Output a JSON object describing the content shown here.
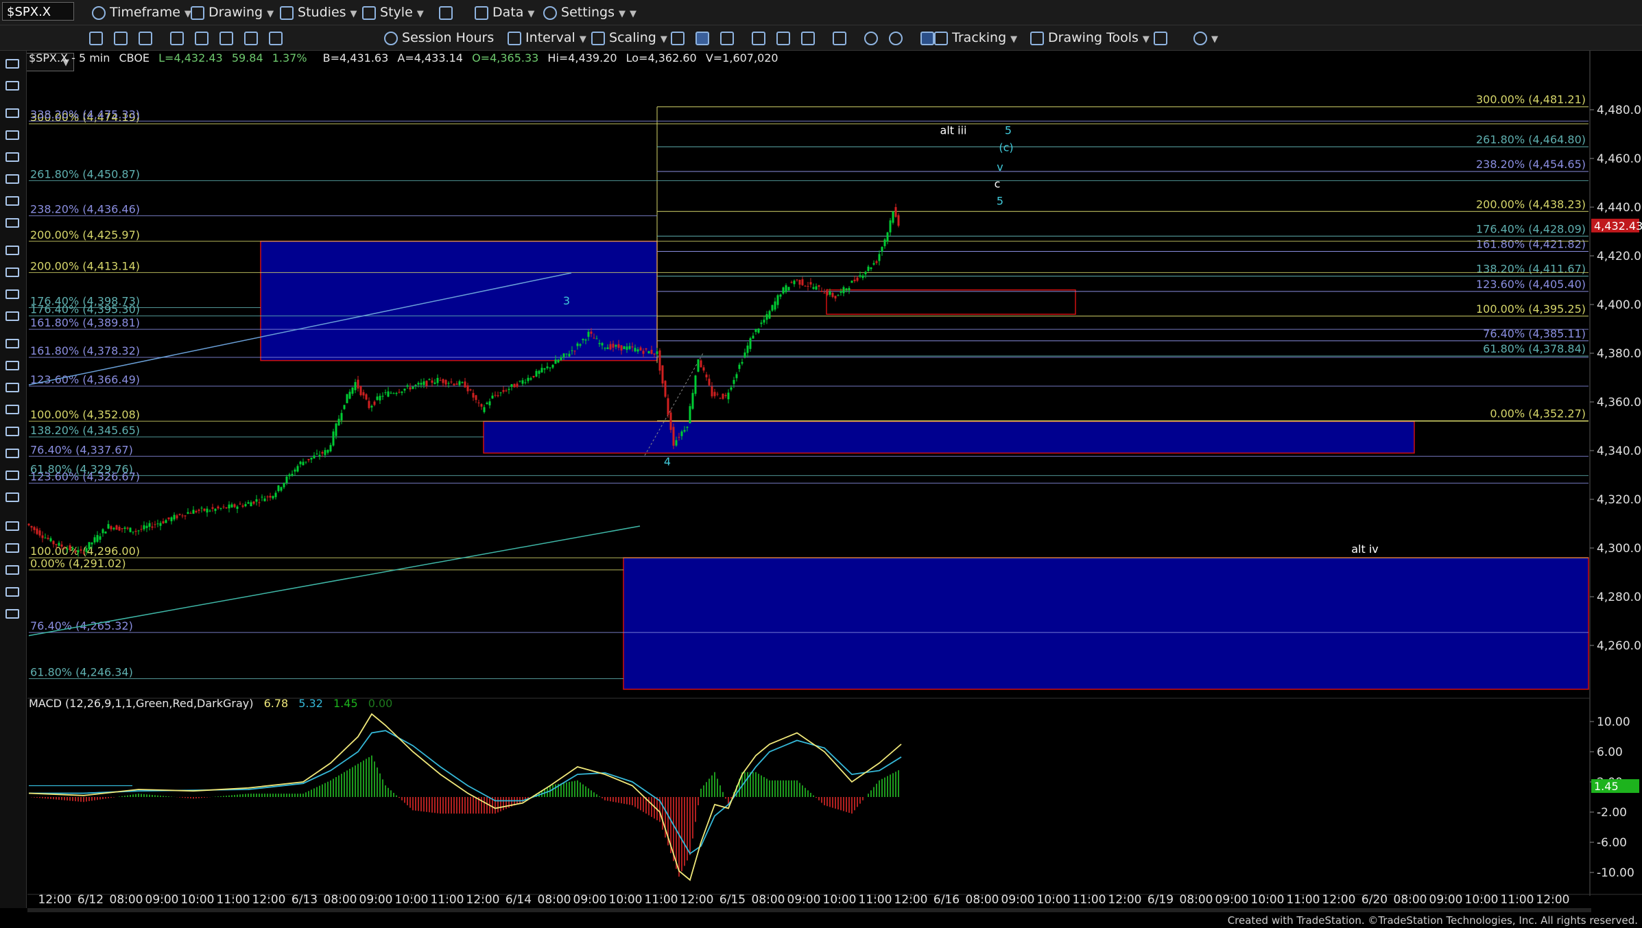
{
  "toolbar": {
    "symbol": "$SPX.X",
    "timeframe": "Timeframe",
    "drawing": "Drawing",
    "studies": "Studies",
    "style": "Style",
    "data": "Data",
    "settings": "Settings",
    "session_hours": "Session Hours",
    "interval": "Interval",
    "scaling": "Scaling",
    "tracking": "Tracking",
    "drawing_tools": "Drawing Tools"
  },
  "header": {
    "symbol": "$SPX.X - 5 min",
    "exchange": "CBOE",
    "last": "L=4,432.43",
    "net_change": "59.84",
    "pct_change": "1.37%",
    "bid": "B=4,431.63",
    "ask": "A=4,433.14",
    "open": "O=4,365.33",
    "high": "Hi=4,439.20",
    "low": "Lo=4,362.60",
    "volume": "V=1,607,020"
  },
  "macd_label": {
    "name": "MACD (12,26,9,1,1,Green,Red,DarkGray)",
    "v1": "6.78",
    "v2": "5.32",
    "v3": "1.45",
    "v4": "0.00"
  },
  "credit": "Created with TradeStation. ©TradeStation Technologies, Inc. All rights reserved.",
  "colors": {
    "background": "#000000",
    "toolbar": "#1b1b1b",
    "zone_fill": "#00008f",
    "zone_border": "#d01010",
    "price_line": "#00cc33",
    "fib_yellow": "#d6d66a",
    "fib_blue": "#8a8ee0",
    "fib_teal": "#5fb0b0",
    "macd_line": "#f0e87a",
    "signal_line": "#35b8d8",
    "hist_pos": "#1d9a1d",
    "hist_neg": "#b02020",
    "last_price_tag": "#c0181c",
    "macd_tag": "#1db31d"
  },
  "chart_data": [
    {
      "type": "candlestick",
      "title": "$SPX.X - 5 min",
      "ylim": [
        4240,
        4490
      ],
      "y_ticks": [
        4260,
        4280,
        4300,
        4320,
        4340,
        4360,
        4380,
        4400,
        4420,
        4440,
        4460,
        4480
      ],
      "y_tick_labels": [
        "4,260.00",
        "4,280.00",
        "4,300.00",
        "4,320.00",
        "4,340.00",
        "4,360.00",
        "4,380.00",
        "4,400.00",
        "4,420.00",
        "4,440.00",
        "4,460.00",
        "4,480.00"
      ],
      "last_price": 4432.43,
      "last_price_label": "4,432.43",
      "x_tick_labels": [
        "12:00",
        "6/12",
        "08:00",
        "09:00",
        "10:00",
        "11:00",
        "12:00",
        "6/13",
        "08:00",
        "09:00",
        "10:00",
        "11:00",
        "12:00",
        "6/14",
        "08:00",
        "09:00",
        "10:00",
        "11:00",
        "12:00",
        "6/15",
        "08:00",
        "09:00",
        "10:00",
        "11:00",
        "12:00",
        "6/16",
        "08:00",
        "09:00",
        "10:00",
        "11:00",
        "12:00",
        "6/19",
        "08:00",
        "09:00",
        "10:00",
        "11:00",
        "12:00",
        "6/20",
        "08:00",
        "09:00",
        "10:00",
        "11:00",
        "12:00"
      ],
      "price_path": [
        [
          0,
          4310
        ],
        [
          1,
          4302
        ],
        [
          2,
          4298
        ],
        [
          3,
          4309
        ],
        [
          4,
          4307
        ],
        [
          5,
          4311
        ],
        [
          6,
          4315
        ],
        [
          7,
          4316
        ],
        [
          8,
          4318
        ],
        [
          9,
          4322
        ],
        [
          10,
          4335
        ],
        [
          11,
          4340
        ],
        [
          11.6,
          4360
        ],
        [
          12,
          4368
        ],
        [
          12.5,
          4358
        ],
        [
          13,
          4363
        ],
        [
          14,
          4366
        ],
        [
          15,
          4369
        ],
        [
          16,
          4367
        ],
        [
          16.6,
          4357
        ],
        [
          17,
          4362
        ],
        [
          18,
          4368
        ],
        [
          19,
          4374
        ],
        [
          20,
          4382
        ],
        [
          20.5,
          4388
        ],
        [
          21,
          4383
        ],
        [
          22,
          4382
        ],
        [
          23,
          4380
        ],
        [
          23.6,
          4343
        ],
        [
          24.1,
          4351
        ],
        [
          24.5,
          4378
        ],
        [
          25,
          4363
        ],
        [
          25.5,
          4362
        ],
        [
          26,
          4375
        ],
        [
          26.5,
          4388
        ],
        [
          27,
          4395
        ],
        [
          27.5,
          4405
        ],
        [
          28,
          4410
        ],
        [
          29,
          4406
        ],
        [
          29.5,
          4403
        ],
        [
          30,
          4408
        ],
        [
          31,
          4418
        ],
        [
          31.4,
          4430
        ],
        [
          31.6,
          4439
        ],
        [
          31.8,
          4432
        ]
      ],
      "annotations": [
        "3",
        "4",
        "alt iii",
        "5",
        "(c)",
        "v",
        "c",
        "5",
        "alt iv"
      ],
      "fib_levels_right": [
        {
          "label": "300.00% (4,481.21)",
          "value": 4481.21
        },
        {
          "label": "261.80% (4,464.80)",
          "value": 4464.8
        },
        {
          "label": "238.20% (4,454.65)",
          "value": 4454.65
        },
        {
          "label": "200.00% (4,438.23)",
          "value": 4438.23
        },
        {
          "label": "176.40% (4,428.09)",
          "value": 4428.09
        },
        {
          "label": "161.80% (4,421.82)",
          "value": 4421.82
        },
        {
          "label": "138.20% (4,411.67)",
          "value": 4411.67
        },
        {
          "label": "123.60% (4,405.40)",
          "value": 4405.4
        },
        {
          "label": "100.00% (4,395.25)",
          "value": 4395.25
        },
        {
          "label": "76.40% (4,385.11)",
          "value": 4385.11
        },
        {
          "label": "61.80% (4,378.84)",
          "value": 4378.84
        },
        {
          "label": "0.00% (4,352.27)",
          "value": 4352.27
        }
      ],
      "fib_levels_left": [
        {
          "label": "300.00% (4,474.19)",
          "value": 4474.19
        },
        {
          "label": "338.20% (4,475.33)",
          "value": 4475.33
        },
        {
          "label": "261.80% (4,450.87)",
          "value": 4450.87
        },
        {
          "label": "238.20% (4,436.46)",
          "value": 4436.46
        },
        {
          "label": "200.00% (4,425.97)",
          "value": 4425.97
        },
        {
          "label": "200.00% (4,413.14)",
          "value": 4413.14
        },
        {
          "label": "176.40% (4,398.73)",
          "value": 4398.73
        },
        {
          "label": "176.40% (4,395.30)",
          "value": 4395.3
        },
        {
          "label": "161.80% (4,389.81)",
          "value": 4389.81
        },
        {
          "label": "161.80% (4,378.32)",
          "value": 4378.32
        },
        {
          "label": "123.60% (4,366.49)",
          "value": 4366.49
        },
        {
          "label": "100.00% (4,352.08)",
          "value": 4352.08
        },
        {
          "label": "138.20% (4,345.65)",
          "value": 4345.65
        },
        {
          "label": "76.40% (4,337.67)",
          "value": 4337.67
        },
        {
          "label": "61.80% (4,329.76)",
          "value": 4329.76
        },
        {
          "label": "123.60% (4,326.67)",
          "value": 4326.67
        },
        {
          "label": "100.00% (4,296.00)",
          "value": 4296.0
        },
        {
          "label": "0.00% (4,291.02)",
          "value": 4291.02
        },
        {
          "label": "76.40% (4,265.32)",
          "value": 4265.32
        },
        {
          "label": "61.80% (4,246.34)",
          "value": 4246.34
        }
      ]
    },
    {
      "type": "line",
      "title": "MACD (12,26,9,1,1,Green,Red,DarkGray)",
      "ylim": [
        -12,
        12
      ],
      "y_ticks": [
        -10,
        -6,
        -2,
        2,
        6,
        10
      ],
      "y_tick_labels": [
        "-10.00",
        "-6.00",
        "-2.00",
        "2.00",
        "6.00",
        "10.00"
      ],
      "last_value": 1.45,
      "macd": [
        [
          0,
          0.5
        ],
        [
          2,
          0.2
        ],
        [
          4,
          1.0
        ],
        [
          6,
          0.8
        ],
        [
          8,
          1.2
        ],
        [
          10,
          2.0
        ],
        [
          11,
          4.5
        ],
        [
          12,
          8.0
        ],
        [
          12.5,
          11.0
        ],
        [
          13,
          9.5
        ],
        [
          14,
          6.0
        ],
        [
          15,
          3.0
        ],
        [
          16,
          0.5
        ],
        [
          17,
          -1.5
        ],
        [
          18,
          -0.8
        ],
        [
          19,
          1.5
        ],
        [
          20,
          4.0
        ],
        [
          21,
          3.0
        ],
        [
          22,
          1.5
        ],
        [
          23,
          -2.0
        ],
        [
          23.7,
          -9.8
        ],
        [
          24.1,
          -11.0
        ],
        [
          24.5,
          -6.0
        ],
        [
          25,
          -1.0
        ],
        [
          25.5,
          -1.5
        ],
        [
          26,
          3.0
        ],
        [
          26.5,
          5.5
        ],
        [
          27,
          7.0
        ],
        [
          28,
          8.5
        ],
        [
          29,
          6.0
        ],
        [
          30,
          2.0
        ],
        [
          31,
          4.5
        ],
        [
          31.8,
          7.0
        ]
      ],
      "signal": [
        [
          0,
          0.5
        ],
        [
          2,
          0.5
        ],
        [
          4,
          0.8
        ],
        [
          6,
          0.9
        ],
        [
          8,
          1.0
        ],
        [
          10,
          1.8
        ],
        [
          11,
          3.5
        ],
        [
          12,
          6.0
        ],
        [
          12.5,
          8.5
        ],
        [
          13,
          8.8
        ],
        [
          14,
          6.8
        ],
        [
          15,
          4.0
        ],
        [
          16,
          1.5
        ],
        [
          17,
          -0.5
        ],
        [
          18,
          -0.5
        ],
        [
          19,
          0.8
        ],
        [
          20,
          3.0
        ],
        [
          21,
          3.2
        ],
        [
          22,
          2.0
        ],
        [
          23,
          -0.5
        ],
        [
          23.7,
          -5.0
        ],
        [
          24.1,
          -7.5
        ],
        [
          24.5,
          -6.5
        ],
        [
          25,
          -2.5
        ],
        [
          25.5,
          -1.0
        ],
        [
          26,
          1.5
        ],
        [
          26.5,
          4.0
        ],
        [
          27,
          6.0
        ],
        [
          28,
          7.5
        ],
        [
          29,
          6.5
        ],
        [
          30,
          3.0
        ],
        [
          31,
          3.5
        ],
        [
          31.8,
          5.3
        ]
      ]
    }
  ]
}
